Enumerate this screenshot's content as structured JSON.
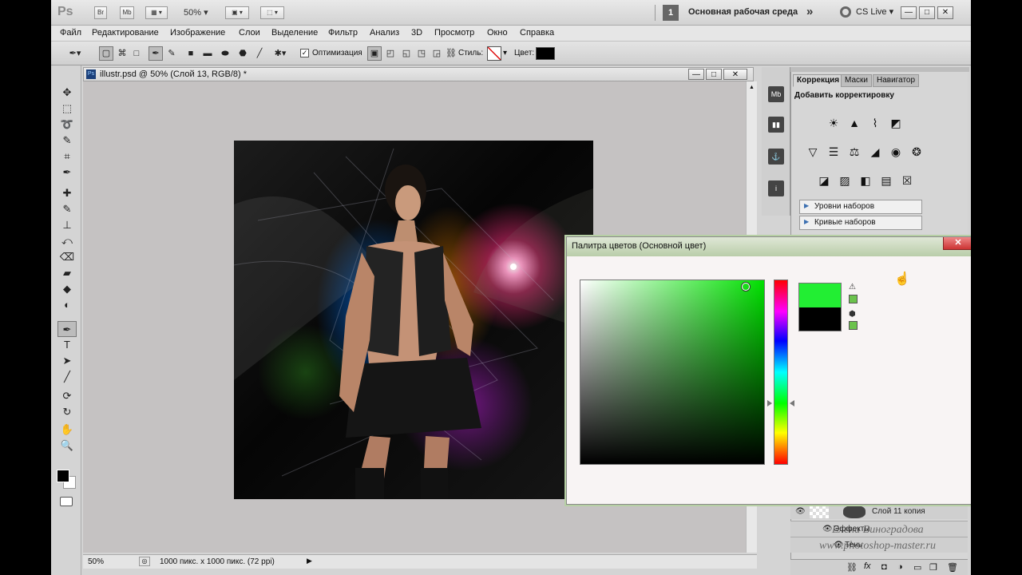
{
  "appbar": {
    "logo": "Ps",
    "bridge_btn": "Br",
    "minibridge_btn": "Mb",
    "zoom": "50%",
    "workspace_num": "1",
    "workspace_label": "Основная рабочая среда",
    "overflow": "»",
    "cslive": "CS Live",
    "win_min": "—",
    "win_max": "□",
    "win_close": "✕"
  },
  "menu": [
    "Файл",
    "Редактирование",
    "Изображение",
    "Слои",
    "Выделение",
    "Фильтр",
    "Анализ",
    "3D",
    "Просмотр",
    "Окно",
    "Справка"
  ],
  "options": {
    "optimize_label": "Оптимизация",
    "styles_label": "Стиль:",
    "color_label": "Цвет:",
    "color_value": "#000000"
  },
  "tools": [
    "move-tool",
    "marquee-tool",
    "lasso-tool",
    "quick-select-tool",
    "crop-tool",
    "eyedropper-tool",
    "spot-heal-tool",
    "brush-tool",
    "clone-stamp-tool",
    "history-brush-tool",
    "eraser-tool",
    "gradient-tool",
    "blur-tool",
    "dodge-tool",
    "pen-tool",
    "type-tool",
    "path-select-tool",
    "shape-tool",
    "3d-rotate-tool",
    "3d-orbit-tool",
    "hand-tool",
    "zoom-tool"
  ],
  "tool_glyphs": [
    "✥",
    "⬚",
    "➰",
    "✎",
    "⌗",
    "✒",
    "✚",
    "✎",
    "⊥",
    "⤺",
    "⌫",
    "▰",
    "◆",
    "◐",
    "✒",
    "T",
    "➤",
    "╱",
    "⟳",
    "↻",
    "✋",
    "🔍"
  ],
  "document": {
    "title": "illustr.psd @ 50% (Слой 13, RGB/8) *",
    "zoom": "50%",
    "status": "1000 пикс. x 1000 пикс. (72 ppi)"
  },
  "panels": {
    "tab_correction": "Коррекция",
    "tab_masks": "Маски",
    "tab_navigator": "Навигатор",
    "heading": "Добавить корректировку",
    "presets": [
      "Уровни наборов",
      "Кривые наборов"
    ]
  },
  "picker": {
    "title": "Палитра цветов (Основной цвет)",
    "close": "✕",
    "new_color": "#22ee33",
    "current_color": "#000000",
    "gamut_color": "#6bc24c",
    "hue_fraction": 0.67
  },
  "layers": {
    "row1": "Слой 11 копия",
    "row2": "Эффекты",
    "row3": "Тень"
  },
  "watermark": {
    "line1": "Елена Виноградова",
    "line2": "www.photoshop-master.ru"
  }
}
